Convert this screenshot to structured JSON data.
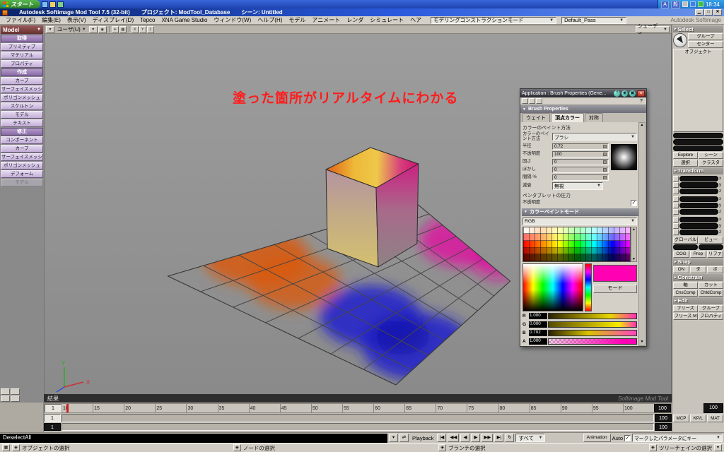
{
  "taskbar": {
    "start": "スタート",
    "ime_a": "A",
    "ime_gen": "般",
    "time": "18:34"
  },
  "titlebar": {
    "app": "Autodesk Softimage Mod Tool 7.5 (32-bit)",
    "project": "プロジェクト: ModTool_Database",
    "scene": "シーン: Untitled"
  },
  "menubar": {
    "items": [
      "ファイル(F)",
      "編集(E)",
      "表示(V)",
      "ディスプレイ(D)",
      "Tepco",
      "XNA Game Studio",
      "ウィンドウ(W)",
      "ヘルプ(H)",
      "モデル",
      "アニメート",
      "レンダ",
      "シミュレート",
      "ヘア"
    ],
    "construction_mode": "モデリングコンストラクションモード",
    "render_pass": "Default_Pass",
    "brand": "Autodesk Softimage"
  },
  "left_panel": {
    "mode": "Model",
    "sections": [
      {
        "header": "取得",
        "items": [
          "プリミティブ",
          "マテリアル",
          "プロパティ"
        ]
      },
      {
        "header": "作成",
        "items": [
          "カーブ",
          "サーフェイスメッシュ",
          "ポリゴンメッシュ",
          "スケルトン",
          "モデル",
          "テキスト"
        ]
      },
      {
        "header": "修正",
        "items": [
          "コンポーネント",
          "カーブ",
          "サーフェイスメッシュ",
          "ポリゴンメッシュ",
          "デフォーム"
        ]
      }
    ],
    "disabled_item": "モデル"
  },
  "viewport": {
    "view_label": "ユーザ(U)",
    "xyz": [
      "X",
      "Y",
      "Z"
    ],
    "shading": "シェーディ",
    "annotation": "塗った箇所がリアルタイムにわかる",
    "axis_x": "X",
    "axis_y": "Y",
    "result": "結果",
    "watermark": "Softimage Mod Tool"
  },
  "scene": {
    "paint_colors": {
      "orange": "#d85a10",
      "magenta": "#e012a0",
      "blue": "#2020cc"
    },
    "cube_top_colors": [
      "#e06018",
      "#eec84a",
      "#cc1070"
    ]
  },
  "timeline": {
    "numbers": [
      "10",
      "15",
      "20",
      "25",
      "30",
      "35",
      "40",
      "45",
      "50",
      "55",
      "60",
      "65",
      "70",
      "75",
      "80",
      "85",
      "90",
      "95",
      "100"
    ],
    "start": "1",
    "end": "100",
    "range_start": "1",
    "range_end": "100",
    "alt_start": "1",
    "alt_end": "100",
    "loop_end": "100"
  },
  "playback": {
    "deselect": "DeselectAll",
    "label": "Playback",
    "transport": [
      "|◀",
      "◀◀",
      "◀",
      "▶",
      "▶▶",
      "▶|",
      "↻"
    ],
    "all": "すべて",
    "animation": "Animation",
    "auto": "Auto",
    "key_field": "マークしたパラメータにキー"
  },
  "status": {
    "items": [
      "オブジェクトの選択",
      "ノードの選択",
      "ブランチの選択",
      "ツリーチェインの選択"
    ]
  },
  "right_panel": {
    "select_header": "Select",
    "group": "グループ",
    "center": "センター",
    "object": "オブジェクト",
    "explore": "Explore",
    "scene": "シーン",
    "sel": "選択",
    "cluster": "クラスタ",
    "transform_header": "Transform",
    "axes": [
      "x",
      "y",
      "z"
    ],
    "global": "グローバル",
    "view_btn": "ビュー",
    "cog": "COG",
    "prop": "Prop",
    "ref": "リファ",
    "snap_header": "Snap",
    "snap_on": "ON",
    "snap_t": "タ",
    "snap_p": "ポ",
    "constrain_header": "Constrain",
    "axis_btn": "軸",
    "cut": "カット",
    "cnscomp": "CnsComp",
    "chldcomp": "ChldComp",
    "edit_header": "Edit",
    "freeze": "フリーズ",
    "edit_group": "グループ",
    "freeze_m": "フリーズ M",
    "edit_prop": "プロパティ",
    "mcp": "MCP",
    "kpl": "KP/L",
    "mat": "MAT"
  },
  "dialog": {
    "title": "Application : Brush Properties (Gene...",
    "title_buttons": [
      "?",
      "◉",
      "▣",
      "×"
    ],
    "help": "?",
    "header": "Brush Properties",
    "tabs": [
      "ウェイト",
      "頂点カラー",
      "対称"
    ],
    "paint_section": "カラーのペイント方法",
    "paint_label": "カラーのペイント方法",
    "brush": "ブラシ",
    "sliders": [
      {
        "label": "半径",
        "value": "0.72"
      },
      {
        "label": "不透明度",
        "value": "100"
      },
      {
        "label": "固さ",
        "value": "0"
      },
      {
        "label": "ぼかし",
        "value": "0"
      },
      {
        "label": "間隔 %",
        "value": "0"
      }
    ],
    "falloff_label": "減衰",
    "falloff_value": "無視",
    "pen_section": "ペンタブレットの圧力",
    "pen_opacity": "不透明度",
    "mode_section": "カラーペイントモード",
    "colorspace": "RGB",
    "mode_button": "モード",
    "channels": [
      {
        "ch": "R",
        "value": "1.000"
      },
      {
        "ch": "G",
        "value": "0.000"
      },
      {
        "ch": "B",
        "value": "0.702"
      },
      {
        "ch": "A",
        "value": "1.000"
      }
    ],
    "current_color": "#ff00b3"
  }
}
